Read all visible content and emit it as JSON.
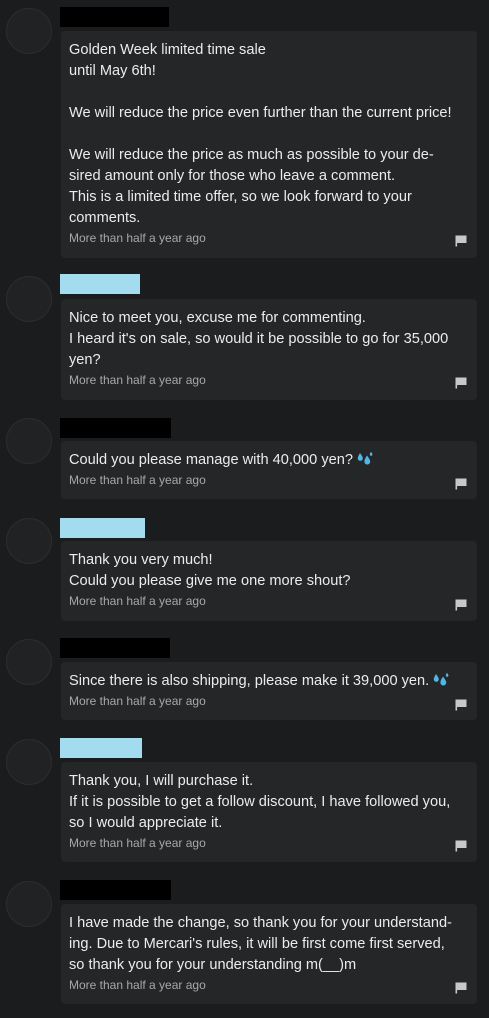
{
  "comments": [
    {
      "user_redaction": "black",
      "text": "Golden Week limited time sale\nuntil May 6th!\n\nWe will reduce the price even further than the current price!\n\nWe will reduce the price as much as possible to your de-\nsired amount only for those who leave a comment.\nThis is a limited time offer, so we look forward to your\ncomments.",
      "time": "More than half a year ago",
      "report_icon": "flag-icon"
    },
    {
      "user_redaction": "blue",
      "text": "Nice to meet you, excuse me for commenting.\nI heard it's on sale, so would it be possible to go for 35,000\nyen?",
      "time": "More than half a year ago",
      "report_icon": "flag-icon"
    },
    {
      "user_redaction": "black",
      "text": "Could you please manage with 40,000 yen?",
      "emoji": "sweat-drops-icon",
      "time": "More than half a year ago",
      "report_icon": "flag-icon"
    },
    {
      "user_redaction": "blue",
      "text": "Thank you very much!\nCould you please give me one more shout?",
      "time": "More than half a year ago",
      "report_icon": "flag-icon"
    },
    {
      "user_redaction": "black",
      "text": "Since there is also shipping, please make it 39,000 yen.",
      "emoji": "sweat-drops-icon",
      "time": "More than half a year ago",
      "report_icon": "flag-icon"
    },
    {
      "user_redaction": "blue",
      "text": "Thank you, I will purchase it.\nIf it is possible to get a follow discount, I have followed you,\nso I would appreciate it.",
      "time": "More than half a year ago",
      "report_icon": "flag-icon"
    },
    {
      "user_redaction": "black",
      "text": "I have made the change, so thank you for your understand-\ning. Due to Mercari's rules, it will be first come first served,\nso thank you for your understanding m(__)m",
      "time": "More than half a year ago",
      "report_icon": "flag-icon"
    }
  ],
  "colors": {
    "background": "#1b1c1e",
    "bubble": "#252628",
    "redaction_black": "#000000",
    "redaction_blue": "#a3dcef",
    "emoji_blue": "#4fb6e8"
  }
}
